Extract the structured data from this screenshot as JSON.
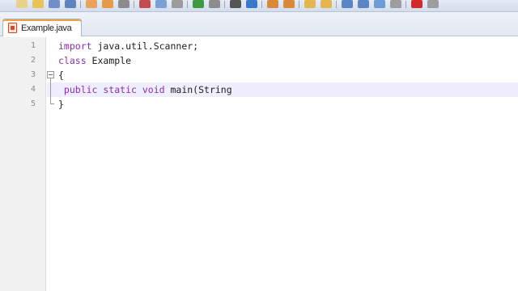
{
  "toolbar": {
    "buttons": [
      {
        "icon": "new-file-icon",
        "color": "#e8d28a"
      },
      {
        "icon": "open-folder-icon",
        "color": "#e9c25a"
      },
      {
        "icon": "save-icon",
        "color": "#6e8fc7"
      },
      {
        "icon": "save-all-icon",
        "color": "#5e84c0"
      },
      {
        "icon": "close-icon",
        "color": "#e9a45a"
      },
      {
        "icon": "close-all-icon",
        "color": "#e59a48"
      },
      {
        "icon": "print-icon",
        "color": "#8b8b8b"
      },
      {
        "icon": "cut-icon",
        "color": "#c44b4b"
      },
      {
        "icon": "copy-icon",
        "color": "#7aa0d4"
      },
      {
        "icon": "paste-icon",
        "color": "#9b9b9b"
      },
      {
        "icon": "undo-icon",
        "color": "#3f9b3f"
      },
      {
        "icon": "redo-icon",
        "color": "#8c8c8c"
      },
      {
        "icon": "find-icon",
        "color": "#555555"
      },
      {
        "icon": "replace-icon",
        "color": "#3c78c8"
      },
      {
        "icon": "zoom-in-icon",
        "color": "#d88a3a"
      },
      {
        "icon": "zoom-out-icon",
        "color": "#d88a3a"
      },
      {
        "icon": "sync-scroll-icon",
        "color": "#e4b650"
      },
      {
        "icon": "sync-view-icon",
        "color": "#e4b650"
      },
      {
        "icon": "word-wrap-icon",
        "color": "#5a86c4"
      },
      {
        "icon": "indent-guide-icon",
        "color": "#5a86c4"
      },
      {
        "icon": "doc-map-icon",
        "color": "#6d9bd6"
      },
      {
        "icon": "function-list-icon",
        "color": "#9d9d9d"
      },
      {
        "icon": "record-macro-icon",
        "color": "#d02a2a"
      },
      {
        "icon": "stop-macro-icon",
        "color": "#9d9d9d"
      }
    ]
  },
  "tab": {
    "label": "Example.java"
  },
  "editor": {
    "lines": [
      {
        "num": "1",
        "tokens": [
          {
            "text": "import",
            "kw": true
          },
          {
            "text": " java.util.Scanner;",
            "kw": false
          }
        ]
      },
      {
        "num": "2",
        "tokens": [
          {
            "text": "class",
            "kw": true
          },
          {
            "text": " Example",
            "kw": false
          }
        ]
      },
      {
        "num": "3",
        "tokens": [
          {
            "text": "{",
            "kw": false
          }
        ]
      },
      {
        "num": "4",
        "tokens": [
          {
            "text": " public static void",
            "kw": true
          },
          {
            "text": " main(String",
            "kw": false
          }
        ]
      },
      {
        "num": "5",
        "tokens": [
          {
            "text": "}",
            "kw": false
          }
        ]
      }
    ],
    "current_line": 4
  }
}
